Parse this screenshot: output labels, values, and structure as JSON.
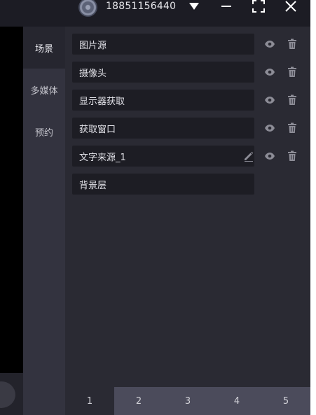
{
  "header": {
    "username": "18851156440",
    "icons": [
      "dropdown-triangle-icon",
      "minimize-icon",
      "fullscreen-icon",
      "close-icon"
    ]
  },
  "sidebar": {
    "tabs": [
      {
        "label": "场景",
        "active": true
      },
      {
        "label": "多媒体",
        "active": false
      },
      {
        "label": "预约",
        "active": false
      }
    ]
  },
  "sources": {
    "items": [
      {
        "label": "图片源",
        "actions": [
          "eye-icon",
          "trash-icon"
        ]
      },
      {
        "label": "摄像头",
        "actions": [
          "eye-icon",
          "trash-icon"
        ]
      },
      {
        "label": "显示器获取",
        "actions": [
          "eye-icon",
          "trash-icon"
        ]
      },
      {
        "label": "获取窗口",
        "actions": [
          "eye-icon",
          "trash-icon"
        ]
      },
      {
        "label": "文字来源_1",
        "actions": [
          "pencil-icon",
          "eye-icon",
          "trash-icon"
        ]
      },
      {
        "label": "背景层",
        "actions": []
      }
    ]
  },
  "pager": {
    "pages": [
      "1",
      "2",
      "3",
      "4",
      "5"
    ],
    "current": "1"
  },
  "colors": {
    "titlebar": "#1c1c24",
    "sidebar": "#33333f",
    "sidebar_active": "#26262f",
    "panel": "#2a2a33",
    "row": "#1d1d24",
    "pager_strip": "#4b4b5b",
    "icon": "#8c8c96"
  }
}
